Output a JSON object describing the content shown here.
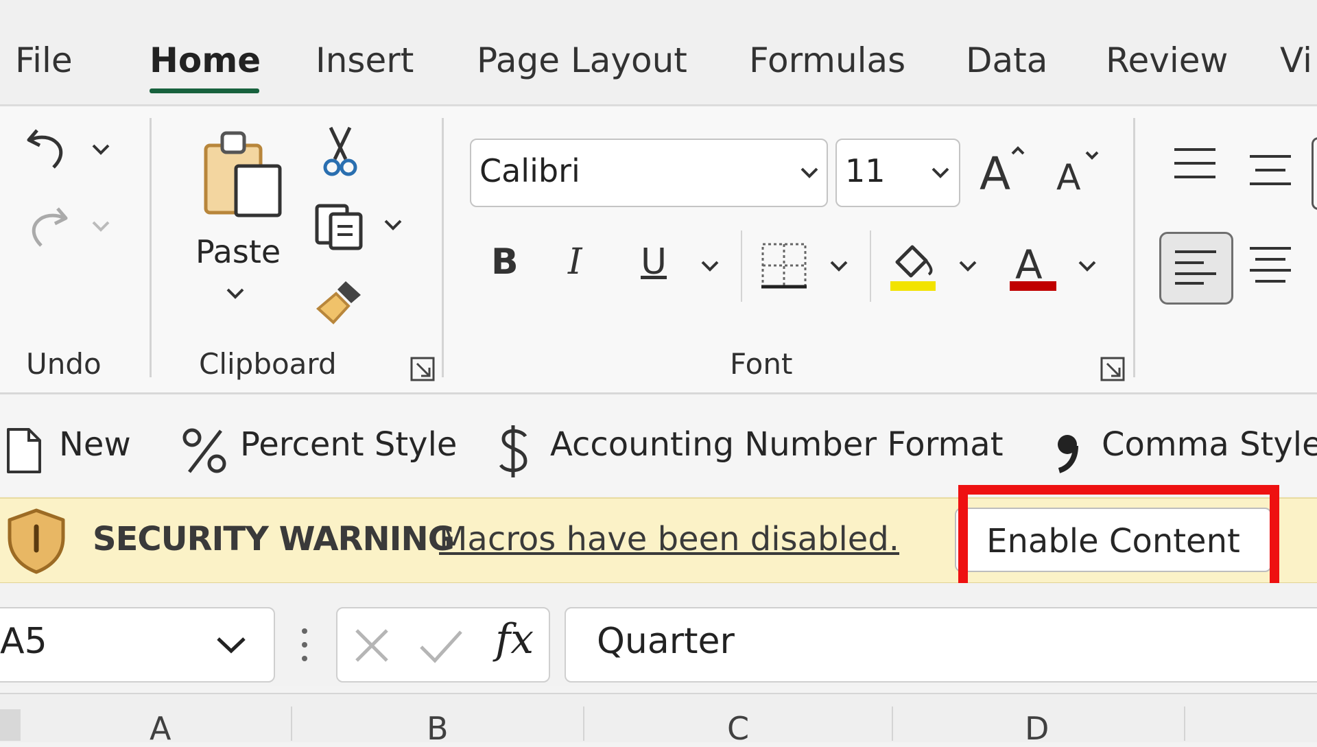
{
  "tabs": [
    "File",
    "Home",
    "Insert",
    "Page Layout",
    "Formulas",
    "Data",
    "Review",
    "Vi"
  ],
  "active_tab": "Home",
  "ribbon": {
    "undo_group_label": "Undo",
    "clipboard": {
      "paste_label": "Paste",
      "group_label": "Clipboard"
    },
    "font": {
      "name": "Calibri",
      "size": "11",
      "group_label": "Font",
      "bold": "B",
      "italic": "I",
      "underline": "U",
      "highlight_color": "#f2e300",
      "font_color": "#c00000"
    }
  },
  "quick_access": {
    "new_label": "New",
    "percent_label": "Percent Style",
    "accounting_label": "Accounting Number Format",
    "comma_label": "Comma Style"
  },
  "security_warning": {
    "title": "SECURITY WARNING",
    "message": "Macros have been disabled.",
    "button": "Enable Content",
    "highlight_color": "#ee1111"
  },
  "formula_bar": {
    "name_box": "A5",
    "fx": "fx",
    "formula": "Quarter"
  },
  "columns": [
    "A",
    "B",
    "C",
    "D"
  ]
}
